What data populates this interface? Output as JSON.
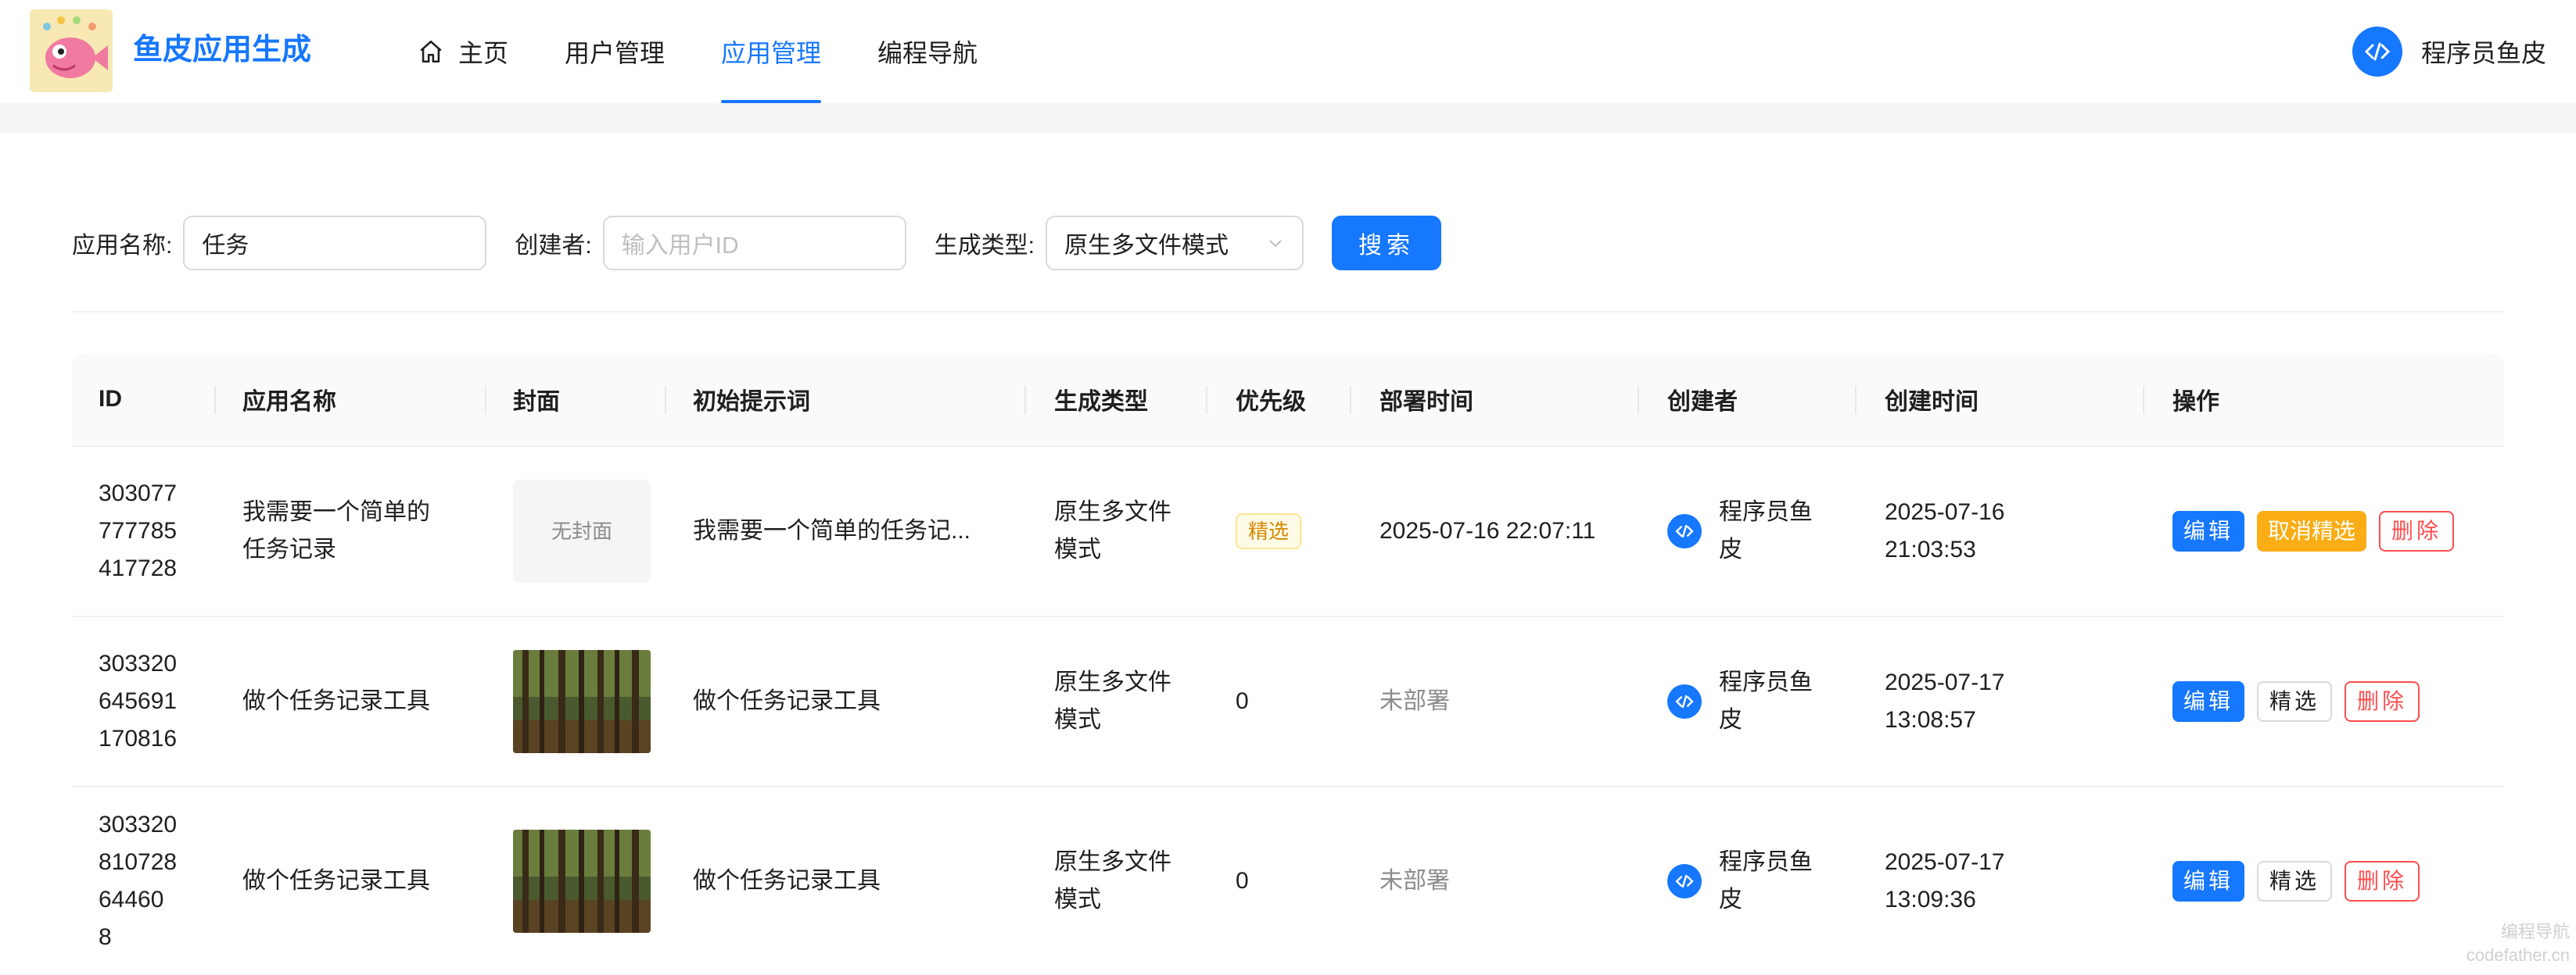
{
  "header": {
    "brand": "鱼皮应用生成",
    "nav": [
      {
        "label": "主页",
        "icon": "home-icon"
      },
      {
        "label": "用户管理"
      },
      {
        "label": "应用管理",
        "active": true
      },
      {
        "label": "编程导航"
      }
    ],
    "user_name": "程序员鱼皮"
  },
  "search": {
    "app_name_label": "应用名称:",
    "app_name_value": "任务",
    "creator_label": "创建者:",
    "creator_placeholder": "输入用户ID",
    "gen_type_label": "生成类型:",
    "gen_type_value": "原生多文件模式",
    "search_button": "搜索"
  },
  "table": {
    "columns": [
      "ID",
      "应用名称",
      "封面",
      "初始提示词",
      "生成类型",
      "优先级",
      "部署时间",
      "创建者",
      "创建时间",
      "操作"
    ],
    "rows": [
      {
        "id_lines": [
          "303077",
          "777785",
          "417728"
        ],
        "name_lines": [
          "我需要一个简单的",
          "任务记录"
        ],
        "cover": "无封面",
        "prompt": "我需要一个简单的任务记...",
        "gen_type_lines": [
          "原生多文件",
          "模式"
        ],
        "priority": "精选",
        "deploy_time": "2025-07-16 22:07:11",
        "creator_lines": [
          "程序员鱼",
          "皮"
        ],
        "created_lines": [
          "2025-07-16",
          "21:03:53"
        ],
        "actions": [
          "编辑",
          "取消精选",
          "删除"
        ]
      },
      {
        "id_lines": [
          "303320",
          "645691",
          "170816"
        ],
        "name_lines": [
          "做个任务记录工具"
        ],
        "cover": "",
        "prompt": "做个任务记录工具",
        "gen_type_lines": [
          "原生多文件",
          "模式"
        ],
        "priority": "0",
        "deploy_time": "未部署",
        "creator_lines": [
          "程序员鱼",
          "皮"
        ],
        "created_lines": [
          "2025-07-17",
          "13:08:57"
        ],
        "actions": [
          "编辑",
          "精选",
          "删除"
        ]
      },
      {
        "id_lines": [
          "303320",
          "810728",
          "64460",
          "8"
        ],
        "name_lines": [
          "做个任务记录工具"
        ],
        "cover": "",
        "prompt": "做个任务记录工具",
        "gen_type_lines": [
          "原生多文件",
          "模式"
        ],
        "priority": "0",
        "deploy_time": "未部署",
        "creator_lines": [
          "程序员鱼",
          "皮"
        ],
        "created_lines": [
          "2025-07-17",
          "13:09:36"
        ],
        "actions": [
          "编辑",
          "精选",
          "删除"
        ]
      }
    ]
  },
  "watermark": [
    "编程导航",
    "codefather.cn"
  ],
  "colors": {
    "primary": "#1677ff",
    "warning": "#faad14",
    "danger": "#ff4d4f"
  }
}
